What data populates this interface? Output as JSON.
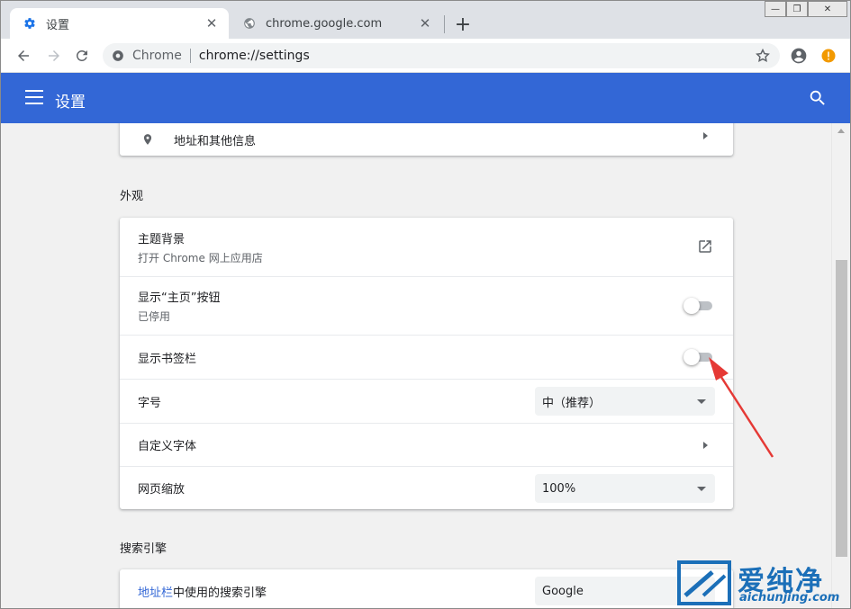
{
  "tabs": [
    {
      "title": "设置",
      "icon": "gear-icon",
      "active": true
    },
    {
      "title": "chrome.google.com",
      "icon": "globe-icon",
      "active": false
    }
  ],
  "new_tab_label": "+",
  "window_controls": {
    "minimize": "—",
    "restore": "❐",
    "close": "✕"
  },
  "omnibox": {
    "chip": "Chrome",
    "url": "chrome://settings"
  },
  "settings_header": {
    "title": "设置"
  },
  "address_row": {
    "label": "地址和其他信息",
    "icon": "location-pin-icon"
  },
  "appearance": {
    "section_title": "外观",
    "theme": {
      "label": "主题背景",
      "sub": "打开 Chrome 网上应用店"
    },
    "home_button": {
      "label": "显示“主页”按钮",
      "sub": "已停用",
      "enabled": false
    },
    "bookmarks_bar": {
      "label": "显示书签栏",
      "enabled": false
    },
    "font_size": {
      "label": "字号",
      "value": "中（推荐）"
    },
    "custom_fonts": {
      "label": "自定义字体"
    },
    "page_zoom": {
      "label": "网页缩放",
      "value": "100%"
    }
  },
  "search_engine": {
    "section_title": "搜索引擎",
    "address_bar": {
      "link": "地址栏",
      "label_rest": "中使用的搜索引擎",
      "value": "Google"
    }
  },
  "watermark": {
    "brand": "爱纯净",
    "url": "aichunjing.com"
  },
  "colors": {
    "header_blue": "#3367d6",
    "annotation_red": "#e53935",
    "watermark_blue": "#1b6fb8"
  }
}
